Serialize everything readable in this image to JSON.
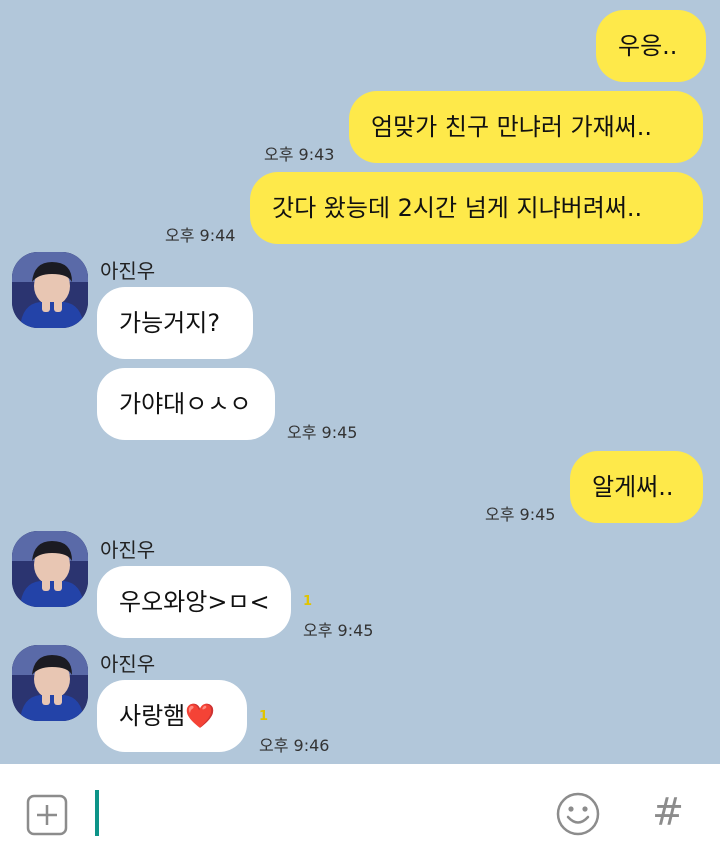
{
  "chat": {
    "sender_name": "아진우",
    "messages": [
      {
        "from": "me",
        "text": "우응..",
        "time": ""
      },
      {
        "from": "me",
        "text": "엄맞가 친구 만냐러 가재써..",
        "time": "오후 9:43"
      },
      {
        "from": "me",
        "text": "갓다 왔능데 2시간 넘게 지냐버려써..",
        "time": "오후 9:44"
      },
      {
        "from": "them",
        "text": "가능거지?",
        "time": ""
      },
      {
        "from": "them",
        "text": "가야대ㅇㅅㅇ",
        "time": "오후 9:45"
      },
      {
        "from": "me",
        "text": "알게써..",
        "time": "오후 9:45"
      },
      {
        "from": "them",
        "text": "우오와앙>ㅁ<",
        "time": "오후 9:45",
        "unread": "1"
      },
      {
        "from": "them",
        "text": "사랑햄❤️",
        "time": "오후 9:46",
        "unread": "1"
      }
    ]
  },
  "input_bar": {
    "value": "",
    "plus_icon": "plus-icon",
    "emoji_icon": "smiley-icon",
    "hash_label": "#"
  },
  "colors": {
    "chat_bg": "#b2c7da",
    "my_bubble": "#fee94a",
    "their_bubble": "#ffffff",
    "caret": "#0d9488",
    "unread": "#e0c400"
  }
}
